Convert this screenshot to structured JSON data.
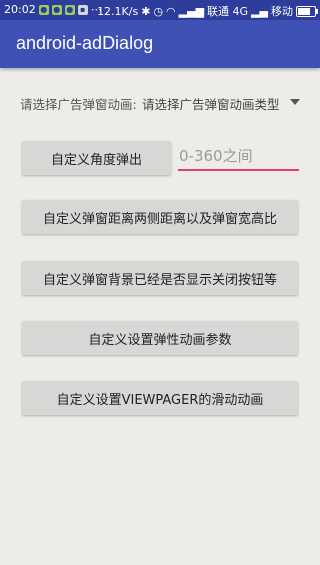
{
  "status_bar": {
    "time": "20:02",
    "net_speed": "12.1K/s",
    "carrier1": "联通 4G",
    "carrier2": "移动",
    "battery_level": 0.75
  },
  "app_bar": {
    "title": "android-adDialog"
  },
  "spinner": {
    "label": "请选择广告弹窗动画:",
    "value": "请选择广告弹窗动画类型"
  },
  "angle": {
    "button_label": "自定义角度弹出",
    "input_placeholder": "0-360之间",
    "input_value": ""
  },
  "buttons": [
    "自定义弹窗距离两侧距离以及弹窗宽高比",
    "自定义弹窗背景已经是否显示关闭按钮等",
    "自定义设置弹性动画参数",
    "自定义设置VIEWPAGER的滑动动画"
  ],
  "colors": {
    "primary": "#3F51B5",
    "primary_dark": "#2E3D9B",
    "accent": "#E0406A",
    "background": "#EDECE8"
  }
}
